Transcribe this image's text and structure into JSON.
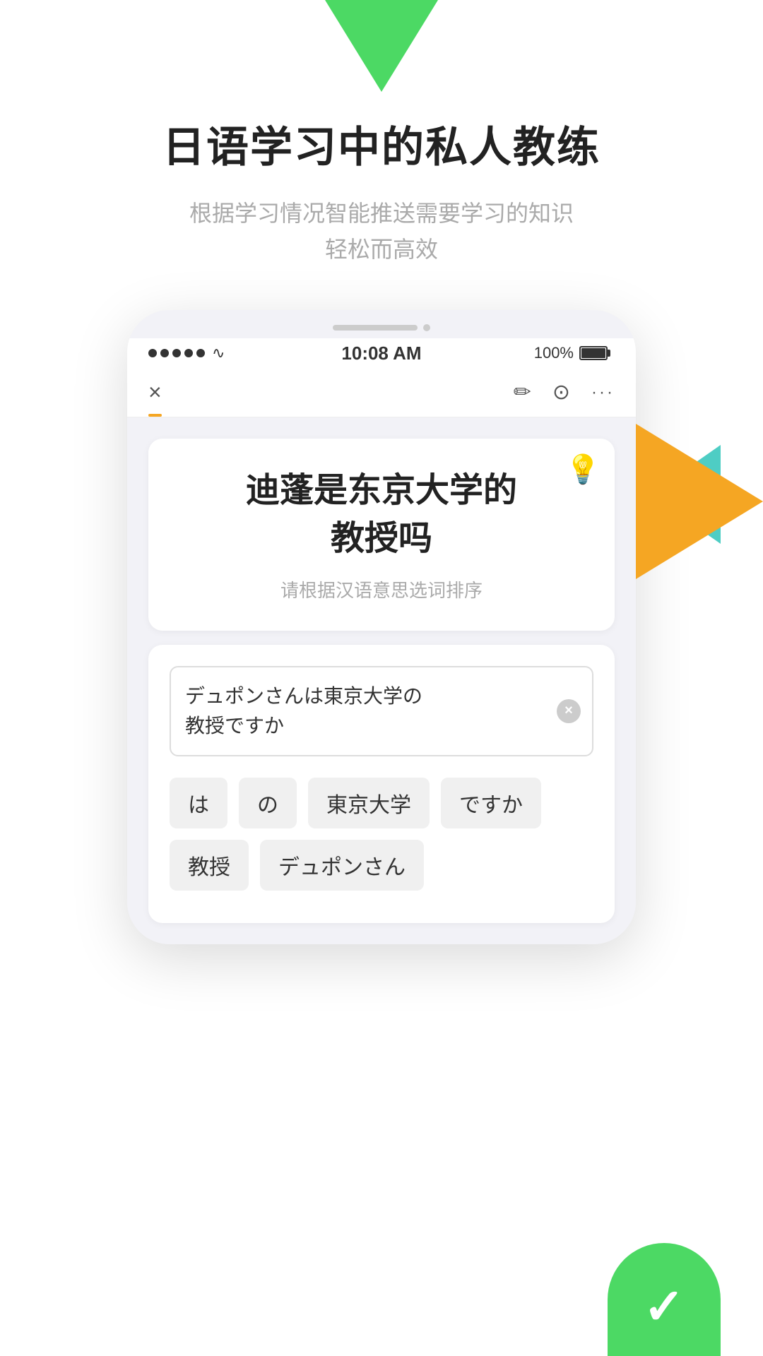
{
  "logo": {
    "alt": "App Logo Triangle"
  },
  "header": {
    "title": "日语学习中的私人教练",
    "subtitle_line1": "根据学习情况智能推送需要学习的知识",
    "subtitle_line2": "轻松而高效"
  },
  "status_bar": {
    "time": "10:08 AM",
    "battery": "100%"
  },
  "toolbar": {
    "close_label": "×",
    "more_label": "···"
  },
  "question": {
    "text_line1": "迪蓬是东京大学的",
    "text_line2": "教授吗",
    "hint": "请根据汉语意思选词排序",
    "hint_icon": "💡"
  },
  "answer": {
    "input_text_line1": "デュポンさんは東京大学の",
    "input_text_line2": "教授ですか",
    "clear_label": "×"
  },
  "word_chips": {
    "row1": [
      "は",
      "の",
      "東京大学",
      "ですか"
    ],
    "row2": [
      "教授",
      "デュポンさん"
    ]
  }
}
